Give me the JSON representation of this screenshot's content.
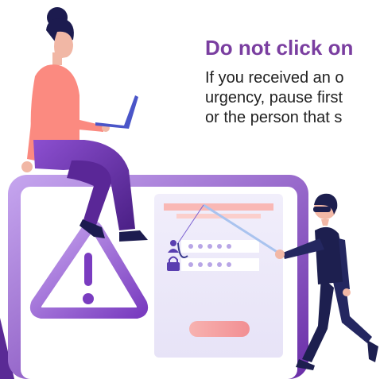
{
  "alert": {
    "title": "Do not click on",
    "lines": [
      "If you received an o",
      "urgency, pause first",
      "or the person that s"
    ]
  },
  "colors": {
    "accent": "#7a3ea0",
    "frame_gradient_start": "#c6a6ef",
    "frame_gradient_end": "#6a2ea8",
    "button": "#f5a1a3",
    "hacker": "#1d1f4f",
    "woman_top": "#fb8a80"
  },
  "icons": {
    "warning": "warning-triangle-icon",
    "user": "user-icon",
    "lock": "padlock-icon"
  }
}
